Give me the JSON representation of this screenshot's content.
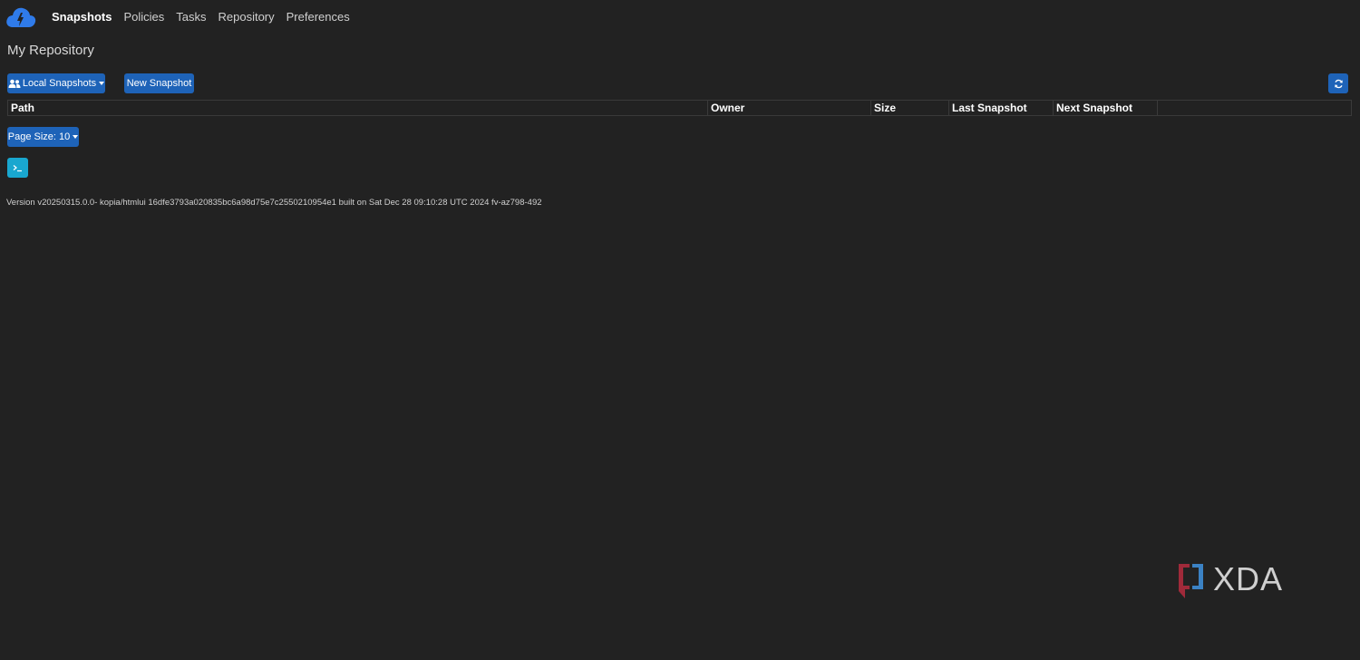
{
  "nav": {
    "items": [
      {
        "label": "Snapshots",
        "active": true
      },
      {
        "label": "Policies",
        "active": false
      },
      {
        "label": "Tasks",
        "active": false
      },
      {
        "label": "Repository",
        "active": false
      },
      {
        "label": "Preferences",
        "active": false
      }
    ]
  },
  "page": {
    "title": "My Repository"
  },
  "toolbar": {
    "local_snapshots_label": "Local Snapshots",
    "new_snapshot_label": "New Snapshot",
    "refresh_icon": "refresh-icon"
  },
  "table": {
    "columns": [
      "Path",
      "Owner",
      "Size",
      "Last Snapshot",
      "Next Snapshot",
      ""
    ],
    "rows": []
  },
  "pagination": {
    "page_size_label": "Page Size: 10"
  },
  "footer": {
    "version_text": "Version v20250315.0.0- kopia/htmlui 16dfe3793a020835bc6a98d75e7c2550210954e1 built on Sat Dec 28 09:10:28 UTC 2024 fv-az798-492"
  },
  "watermark": {
    "text": "XDA"
  },
  "colors": {
    "background": "#222222",
    "primary": "#1e63b8",
    "info": "#19a7cf",
    "logo_blue": "#2f7bea"
  }
}
